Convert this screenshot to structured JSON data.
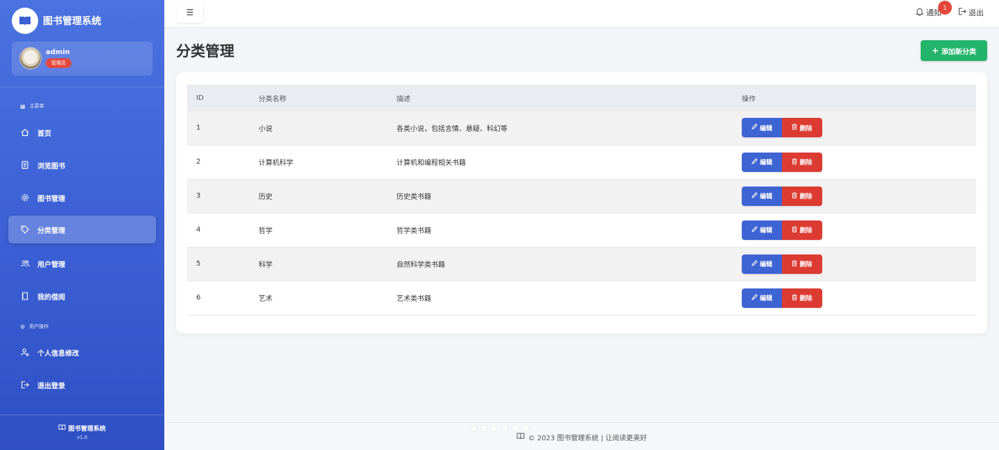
{
  "brand": {
    "title": "图书管理系统"
  },
  "user": {
    "name": "admin",
    "role": "管理员"
  },
  "sidebar": {
    "section_main": "主菜单",
    "section_user": "用户操作",
    "items": [
      {
        "label": "首页",
        "icon": "home-icon"
      },
      {
        "label": "浏览图书",
        "icon": "book-browse-icon"
      },
      {
        "label": "图书管理",
        "icon": "gear-icon"
      },
      {
        "label": "分类管理",
        "icon": "tag-icon",
        "active": true
      },
      {
        "label": "用户管理",
        "icon": "users-icon"
      },
      {
        "label": "我的借阅",
        "icon": "journal-icon"
      },
      {
        "label": "个人信息修改",
        "icon": "person-gear-icon"
      },
      {
        "label": "退出登录",
        "icon": "logout-icon"
      }
    ],
    "footer_title": "图书管理系统",
    "footer_version": "v1.0"
  },
  "topbar": {
    "notify_label": "通知",
    "notify_count": "1",
    "logout_label": "退出"
  },
  "main": {
    "title": "分类管理",
    "add_button": "添加新分类",
    "table": {
      "headers": [
        "ID",
        "分类名称",
        "描述",
        "操作"
      ],
      "rows": [
        {
          "id": "1",
          "name": "小说",
          "desc": "各类小说，包括言情、悬疑、科幻等"
        },
        {
          "id": "2",
          "name": "计算机科学",
          "desc": "计算机和编程相关书籍"
        },
        {
          "id": "3",
          "name": "历史",
          "desc": "历史类书籍"
        },
        {
          "id": "4",
          "name": "哲学",
          "desc": "哲学类书籍"
        },
        {
          "id": "5",
          "name": "科学",
          "desc": "自然科学类书籍"
        },
        {
          "id": "6",
          "name": "艺术",
          "desc": "艺术类书籍"
        }
      ],
      "edit_label": "编辑",
      "delete_label": "删除"
    }
  },
  "footer": {
    "text": "© 2023 图书管理系统 | 让阅读更美好"
  },
  "colors": {
    "sidebar": "#3b5fd4",
    "primary": "#3e63d3",
    "danger": "#dc3b32",
    "success": "#23b46b"
  }
}
